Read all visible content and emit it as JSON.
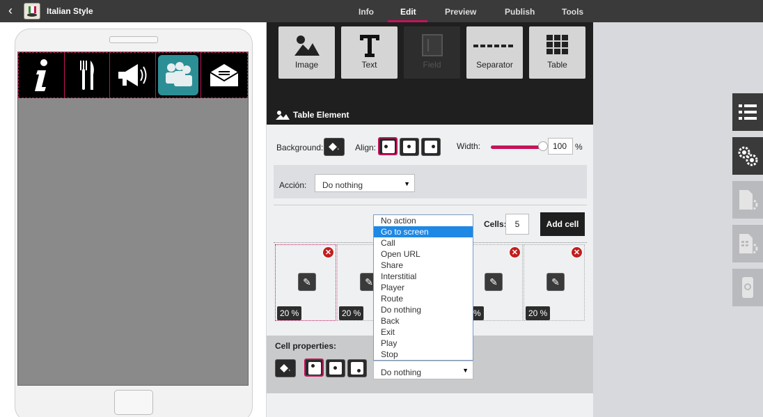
{
  "topbar": {
    "back_glyph": "‹",
    "app_icon": "app-icon",
    "app_title": "Italian Style",
    "tabs": [
      {
        "label": "Info",
        "active": false
      },
      {
        "label": "Edit",
        "active": true
      },
      {
        "label": "Preview",
        "active": false
      },
      {
        "label": "Publish",
        "active": false
      },
      {
        "label": "Tools",
        "active": false
      }
    ],
    "active_color": "#c4145a"
  },
  "phone": {
    "icon_bar": [
      "info-icon",
      "cutlery-icon",
      "megaphone-icon",
      "people-icon",
      "mail-icon"
    ],
    "selected_icon": "people-icon"
  },
  "toolbox": {
    "tools": [
      {
        "label": "Image",
        "icon": "image-icon",
        "enabled": true
      },
      {
        "label": "Text",
        "icon": "text-icon",
        "enabled": true
      },
      {
        "label": "Field",
        "icon": "field-icon",
        "enabled": false
      },
      {
        "label": "Separator",
        "icon": "separator-icon",
        "enabled": true
      },
      {
        "label": "Table",
        "icon": "table-icon",
        "enabled": true
      }
    ],
    "section_title": "Table Element"
  },
  "table_element": {
    "background_label": "Background:",
    "align_label": "Align:",
    "width_label": "Width:",
    "width_value": "100",
    "width_unit": "%",
    "accion_label": "Acción:",
    "accion_value": "Do nothing",
    "cells_label": "Cells:",
    "cells_value": "5",
    "add_cell_label": "Add cell"
  },
  "cells": [
    {
      "pct": "20 %",
      "selected": true
    },
    {
      "pct": "20 %",
      "selected": false
    },
    {
      "pct": "0 %",
      "selected": false
    },
    {
      "pct": "20 %",
      "selected": false
    }
  ],
  "cell_properties": {
    "label": "Cell properties:",
    "action_value": "Do nothing"
  },
  "dropdown": {
    "options": [
      "No action",
      "Go to screen",
      "Call",
      "Open URL",
      "Share",
      "Interstitial",
      "Player",
      "Route",
      "Do nothing",
      "Back",
      "Exit",
      "Play",
      "Stop"
    ],
    "highlighted": "Go to screen"
  },
  "sidebar": {
    "buttons": [
      "list-icon",
      "gears-icon",
      "doc-settings-icon",
      "table-settings-icon",
      "phone-settings-icon"
    ]
  }
}
